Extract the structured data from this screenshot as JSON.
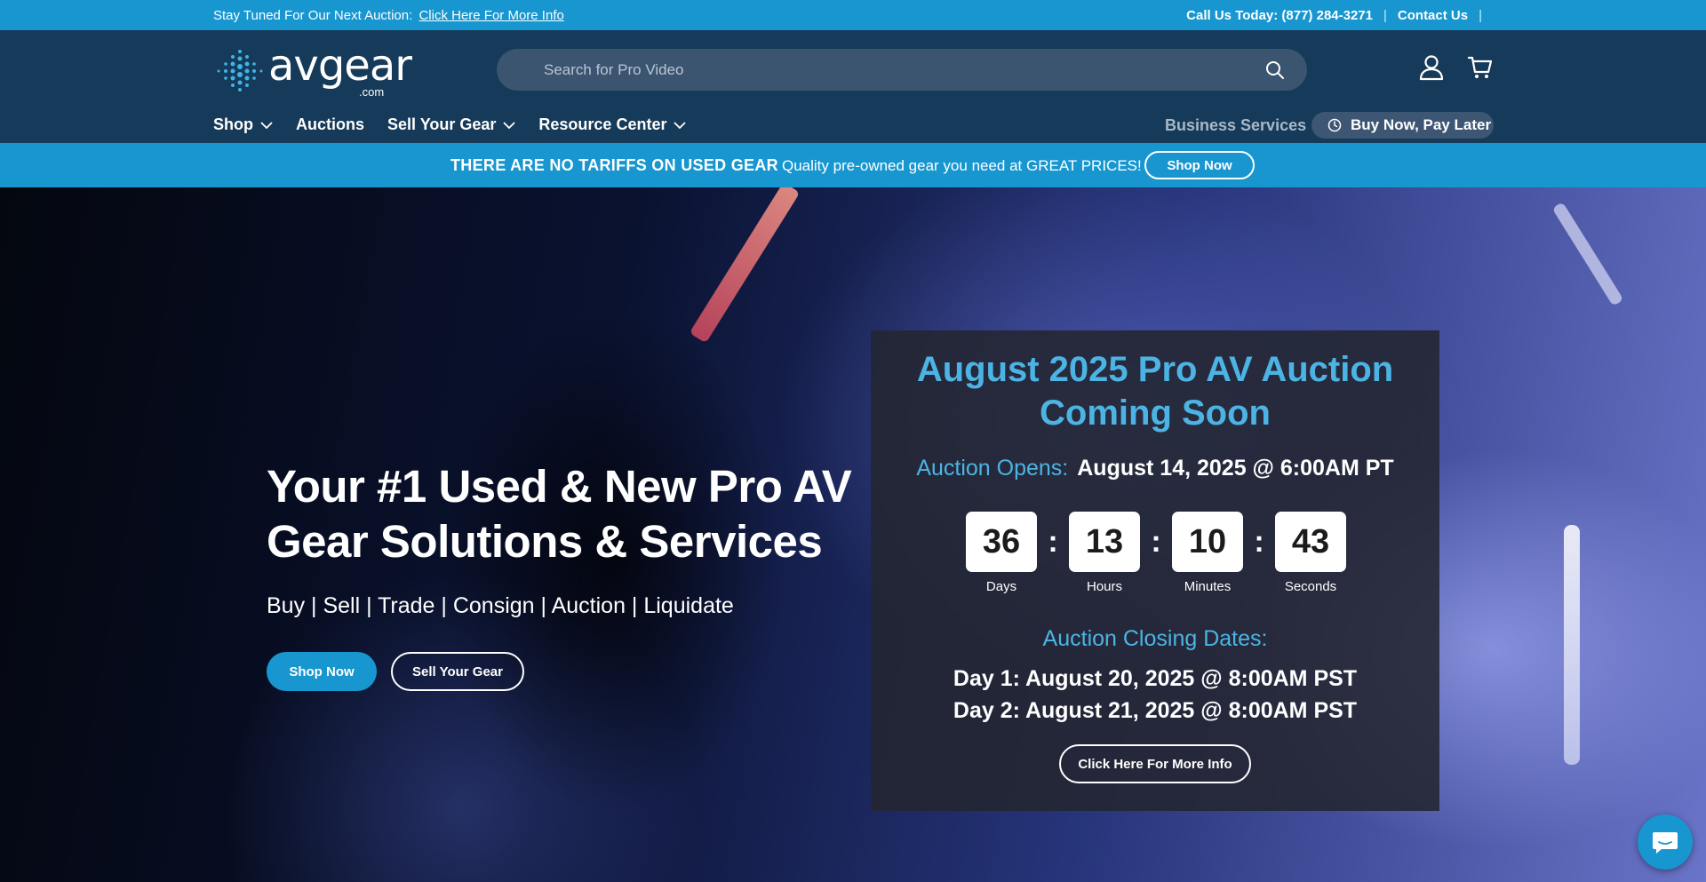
{
  "topbar": {
    "notice": "Stay Tuned For Our Next Auction:",
    "notice_link": "Click Here For More Info",
    "call": "Call Us Today: (877) 284-3271",
    "sep": "|",
    "contact": "Contact Us"
  },
  "header": {
    "logo_word": "avgear",
    "logo_dotcom": ".com",
    "search_placeholder": "Search for Pro Video",
    "nav": {
      "shop": "Shop",
      "auctions": "Auctions",
      "sell": "Sell Your Gear",
      "resources": "Resource Center"
    },
    "business": "Business Services",
    "bnpl": "Buy Now, Pay Later",
    "icons": [
      "account-icon",
      "cart-icon",
      "search-icon"
    ]
  },
  "promo": {
    "headline": "THERE ARE NO TARIFFS ON USED GEAR",
    "text": "Quality pre-owned gear you need at GREAT PRICES!",
    "button": "Shop Now"
  },
  "hero": {
    "title": "Your #1 Used & New Pro AV Gear Solutions & Services",
    "subtitle": "Buy | Sell | Trade | Consign | Auction | Liquidate",
    "shop_button": "Shop Now",
    "sell_button": "Sell Your Gear"
  },
  "auction": {
    "title": "August 2025 Pro AV Auction Coming Soon",
    "opens_label": "Auction Opens:",
    "opens_value": "August 14, 2025 @ 6:00AM PT",
    "countdown": {
      "days": "36",
      "hours": "13",
      "minutes": "10",
      "seconds": "43",
      "days_label": "Days",
      "hours_label": "Hours",
      "minutes_label": "Minutes",
      "seconds_label": "Seconds",
      "colon": ":"
    },
    "closing_title": "Auction Closing Dates:",
    "day1": "Day 1: August 20, 2025 @ 8:00AM PST",
    "day2": "Day 2: August 21, 2025 @ 8:00AM PST",
    "more_button": "Click Here For More Info"
  },
  "colors": {
    "brand_blue": "#1796d0",
    "header_bg": "#163a59",
    "accent_text": "#4cb4e4"
  }
}
